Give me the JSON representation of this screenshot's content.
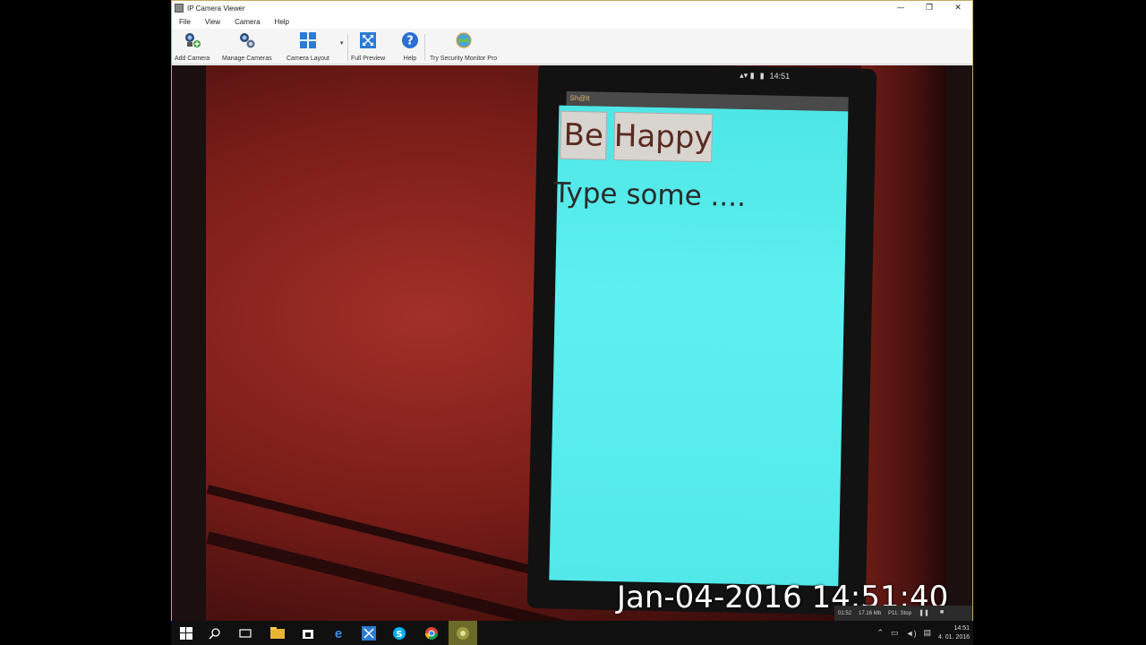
{
  "window": {
    "title": "IP Camera Viewer",
    "controls": {
      "minimize": "—",
      "maximize": "❐",
      "close": "✕"
    }
  },
  "menu": [
    "File",
    "View",
    "Camera",
    "Help"
  ],
  "toolbar": {
    "add_camera": "Add Camera",
    "manage_cameras": "Manage Cameras",
    "camera_layout": "Camera Layout",
    "full_preview": "Full Preview",
    "help": "Help",
    "try_pro": "Try Security Monitor Pro"
  },
  "video": {
    "phone_status": "14:51",
    "app_header": "Sh@lt",
    "button_be": "Be",
    "button_happy": "Happy",
    "type_text": "Type some ....",
    "timestamp": "Jan-04-2016 14:51:40",
    "stats": {
      "duration": "01:52",
      "size": "17.16 Mb",
      "speed": "P11: Stop"
    }
  },
  "taskbar": {
    "time": "14:51",
    "date": "4. 01. 2016"
  }
}
